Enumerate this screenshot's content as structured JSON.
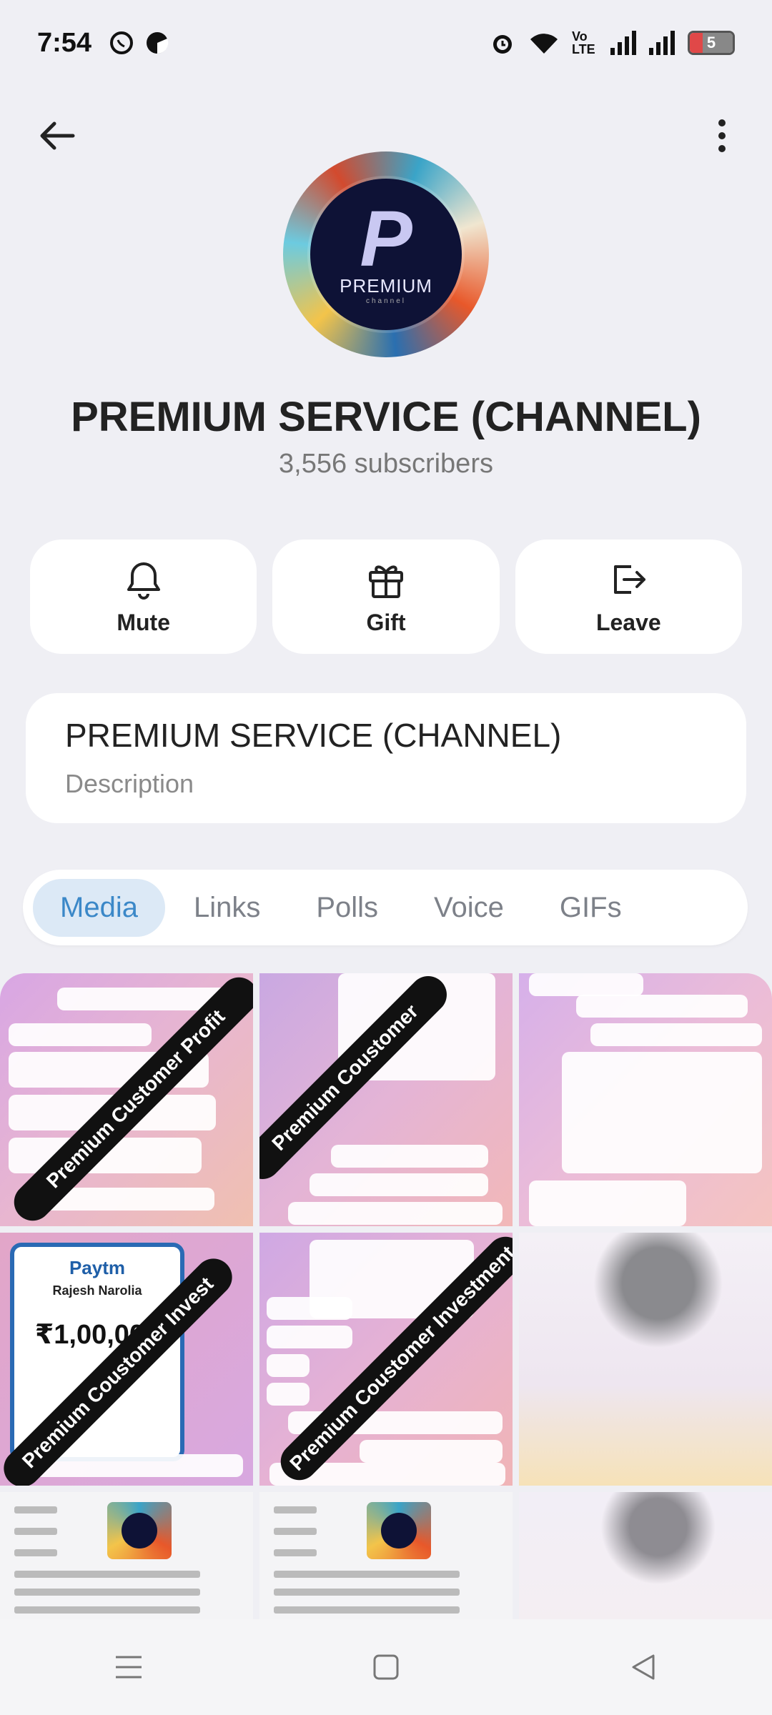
{
  "status_bar": {
    "time": "7:54",
    "network_label": "Vo LTE",
    "battery_level": "5",
    "icons": [
      "whatsapp-icon",
      "chrome-icon",
      "alarm-icon",
      "wifi-icon",
      "volte-icon",
      "signal-icon",
      "battery-icon"
    ]
  },
  "header": {
    "back_icon": "arrow-left-icon",
    "more_icon": "more-vertical-icon"
  },
  "channel": {
    "avatar_text": "PREMIUM",
    "avatar_subtext": "channel",
    "title": "PREMIUM SERVICE (CHANNEL)",
    "subscribers": "3,556 subscribers"
  },
  "actions": [
    {
      "label": "Mute",
      "icon": "bell-icon"
    },
    {
      "label": "Gift",
      "icon": "gift-icon"
    },
    {
      "label": "Leave",
      "icon": "leave-icon"
    }
  ],
  "info": {
    "title": "PREMIUM SERVICE (CHANNEL)",
    "subtitle": "Description"
  },
  "tabs": [
    {
      "label": "Media",
      "active": true
    },
    {
      "label": "Links",
      "active": false
    },
    {
      "label": "Polls",
      "active": false
    },
    {
      "label": "Voice",
      "active": false
    },
    {
      "label": "GIFs",
      "active": false
    }
  ],
  "media": {
    "banners": [
      "Premium Customer Profit",
      "Premium Coustomer",
      "Premium Coustomer Invest",
      "Premium Coustomer Investment"
    ],
    "paytm": {
      "logo": "Paytm",
      "name": "Rajesh Narolia",
      "amount": "₹1,00,000"
    }
  },
  "colors": {
    "background": "#efeff4",
    "accent": "#3b88c8",
    "tab_active_bg": "#dce9f6"
  },
  "navbar": {
    "icons": [
      "menu-icon",
      "home-square-icon",
      "back-triangle-icon"
    ]
  }
}
